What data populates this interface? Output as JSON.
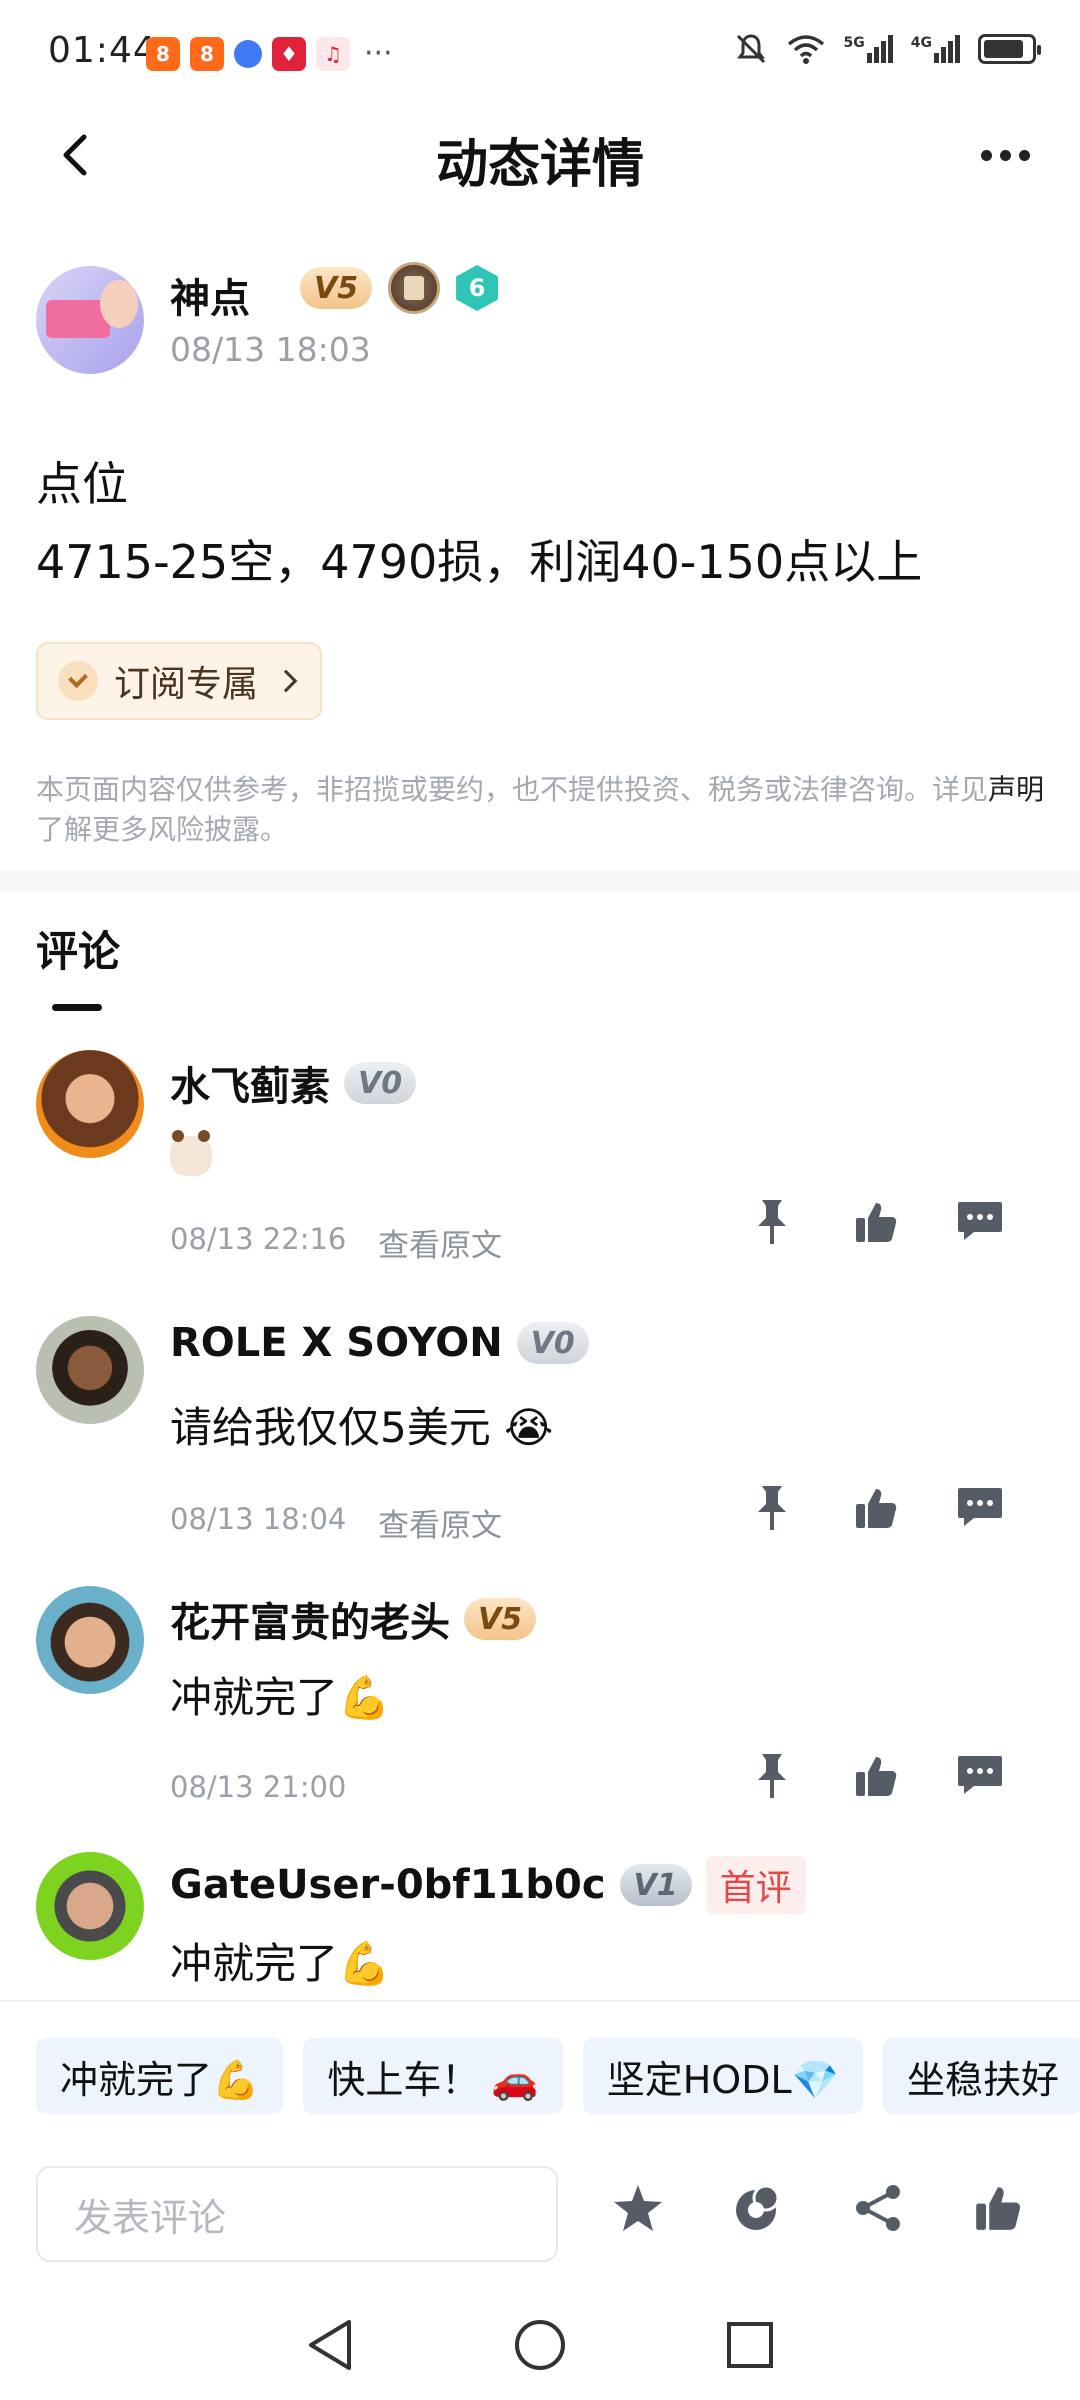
{
  "status_bar": {
    "time": "01:44",
    "left_icons": [
      "orange-app-icon",
      "orange-app-icon",
      "blue-browser-icon",
      "red-app-icon",
      "music-icon"
    ],
    "more": "···",
    "right_icons": [
      "mute-icon",
      "wifi-icon",
      "signal-5g-icon",
      "signal-4g-icon",
      "battery-icon"
    ],
    "signal_5g": "5G",
    "signal_4g": "4G",
    "battery_level": 0.85
  },
  "header": {
    "title": "动态详情"
  },
  "author": {
    "name": "神点",
    "level": "V5",
    "time": "08/13 18:03",
    "rank": "6"
  },
  "post": {
    "line1": "点位",
    "line2": "4715-25空，4790损，利润40-150点以上"
  },
  "subscribe": {
    "label": "订阅专属"
  },
  "disclaimer": {
    "text1": "本页面内容仅供参考，非招揽或要约，也不提供投资、税务或法律咨询。详见",
    "link": "声明",
    "text2": "了解更多风险披露。"
  },
  "comments_section": {
    "title": "评论"
  },
  "comments": [
    {
      "name": "水飞蓟素",
      "level": "V0",
      "text": "",
      "emoji": "cow-emoji",
      "time": "08/13 22:16",
      "view_original": "查看原文"
    },
    {
      "name": "ROLE X SOYON",
      "level": "V0",
      "text": "请给我仅仅5美元 😭",
      "time": "08/13 18:04",
      "view_original": "查看原文"
    },
    {
      "name": "花开富贵的老头",
      "level": "V5",
      "text": "冲就完了💪",
      "time": "08/13 21:00"
    },
    {
      "name": "GateUser-0bf11b0c",
      "level": "V1",
      "first_badge": "首评",
      "text": "冲就完了💪"
    }
  ],
  "quick_replies": [
    "冲就完了💪",
    "快上车！ 🚗",
    "坚定HODL💎",
    "坐稳扶好"
  ],
  "bottom_bar": {
    "input_placeholder": "发表评论"
  },
  "colors": {
    "accent_gold": "#f3c48a",
    "first_badge_red": "#e64848",
    "muted_text": "#9aa0a8"
  }
}
